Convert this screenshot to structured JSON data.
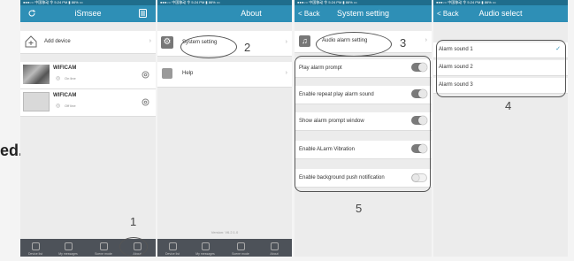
{
  "edge_text": "ed.",
  "screen1": {
    "status": "●●●○○ 中国移动 令   5:24 PM   ▮ 86% ▭",
    "title": "iSmsee",
    "add_device": "Add device",
    "devices": [
      {
        "name": "WIFICAM",
        "status": "On line"
      },
      {
        "name": "WIFICAM",
        "status": "Off line"
      }
    ],
    "tabs": [
      "Device list",
      "My messages",
      "Scene mode",
      "About"
    ]
  },
  "screen2": {
    "status": "●●●○○ 中国移动 令   5:24 PM   ▮ 86% ▭",
    "title": "About",
    "items": [
      "System setting",
      "Help"
    ],
    "version": "Version: V6.2.1.0",
    "tabs": [
      "Device list",
      "My messages",
      "Scene mode",
      "About"
    ]
  },
  "screen3": {
    "status": "●●●○○ 中国移动 令   5:24 PM   ▮ 86% ▭",
    "back": "< Back",
    "title": "System setting",
    "header_item": "Audio alarm setting",
    "settings": [
      {
        "label": "Play alarm prompt",
        "on": true
      },
      {
        "label": "Enable repeat play alarm sound",
        "on": true
      },
      {
        "label": "Show alarm prompt window",
        "on": true
      },
      {
        "label": "Enable ALarm Vibration",
        "on": true
      },
      {
        "label": "Enable background push notification",
        "on": false
      }
    ]
  },
  "screen4": {
    "status": "●●●○○ 中国移动 令   5:24 PM   ▮ 86% ▭",
    "back": "< Back",
    "title": "Audio select",
    "sounds": [
      "Alarm sound 1",
      "Alarm sound 2",
      "Alarm sound 3"
    ],
    "selected_index": 0
  },
  "annotations": [
    "1",
    "2",
    "3",
    "4",
    "5"
  ]
}
